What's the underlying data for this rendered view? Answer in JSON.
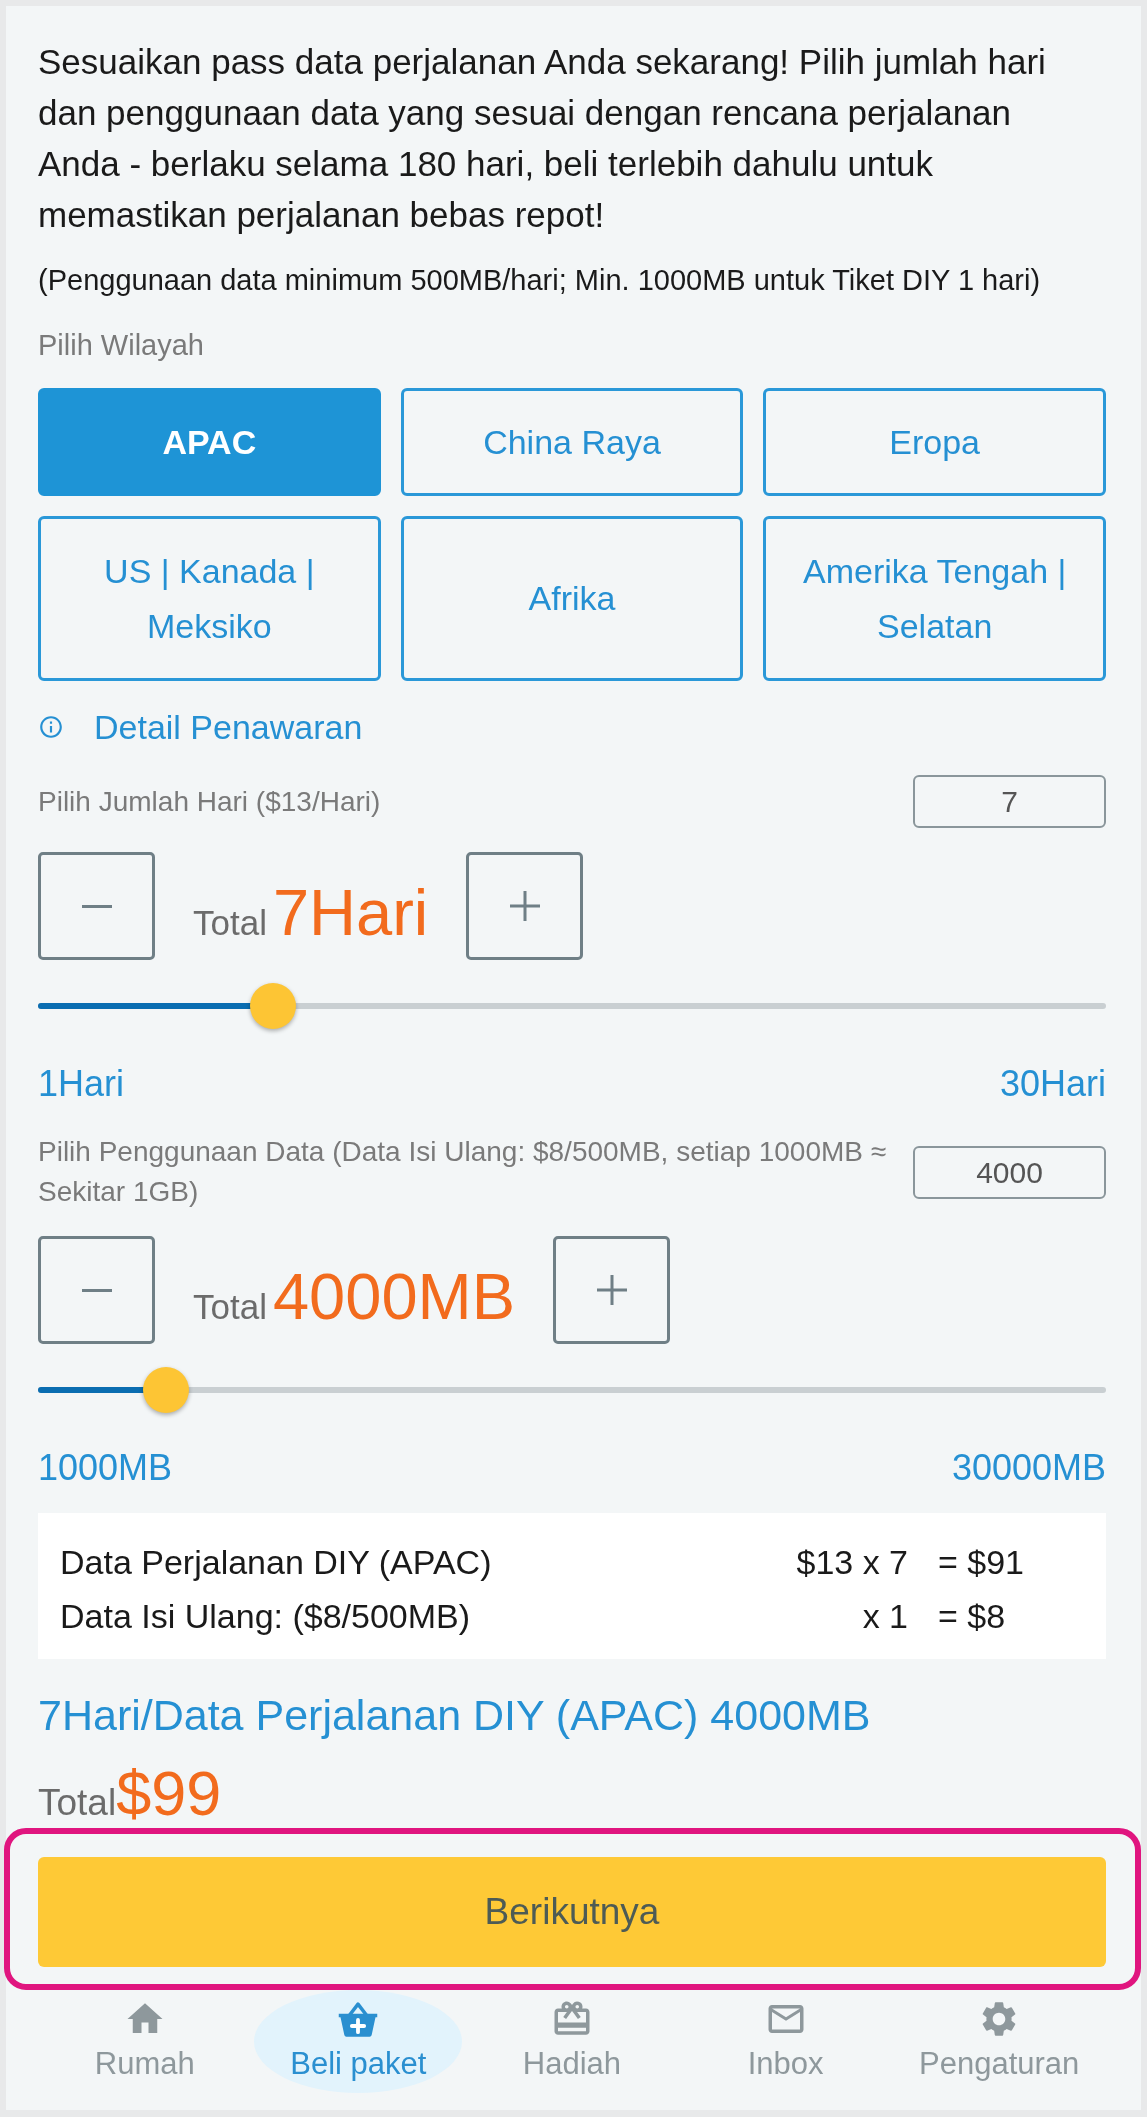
{
  "intro": {
    "text": "Sesuaikan pass data perjalanan Anda sekarang! Pilih jumlah hari dan penggunaan data yang sesuai dengan rencana perjalanan Anda - berlaku selama 180 hari, beli terlebih dahulu untuk memastikan perjalanan bebas repot!",
    "note": "(Penggunaan data minimum 500MB/hari; Min. 1000MB untuk Tiket DIY 1 hari)"
  },
  "region": {
    "label": "Pilih Wilayah",
    "options": [
      {
        "label": "APAC",
        "selected": true
      },
      {
        "label": "China Raya",
        "selected": false
      },
      {
        "label": "Eropa",
        "selected": false
      },
      {
        "label": "US | Kanada | Meksiko",
        "selected": false
      },
      {
        "label": "Afrika",
        "selected": false
      },
      {
        "label": "Amerika Tengah | Selatan",
        "selected": false
      }
    ],
    "detail_link": "Detail Penawaran"
  },
  "days": {
    "label": "Pilih Jumlah Hari ($13/Hari)",
    "value": "7",
    "total_label": "Total",
    "total": "7Hari",
    "level": 0.22,
    "min_label": "1Hari",
    "max_label": "30Hari"
  },
  "data": {
    "label": "Pilih Penggunaan Data (Data Isi Ulang: $8/500MB, setiap 1000MB ≈ Sekitar 1GB)",
    "value": "4000",
    "total_label": "Total",
    "total": "4000MB",
    "level": 0.12,
    "min_label": "1000MB",
    "max_label": "30000MB"
  },
  "summary": {
    "rows": [
      {
        "item": "Data Perjalanan DIY (APAC)",
        "quantity": "$13 x 7",
        "amount": "= $91"
      },
      {
        "item": "Data Isi Ulang: ($8/500MB)",
        "quantity": "x 1",
        "amount": "= $8"
      }
    ]
  },
  "plan_title": "7Hari/Data Perjalanan DIY (APAC) 4000MB",
  "total": {
    "label": "Total",
    "amount": "$99"
  },
  "next_button": {
    "label": "Berikutnya",
    "highlighted": true
  },
  "bottom_nav": [
    {
      "label": "Rumah",
      "selected": false
    },
    {
      "label": "Beli paket",
      "selected": true
    },
    {
      "label": "Hadiah",
      "selected": false
    },
    {
      "label": "Inbox",
      "selected": false
    },
    {
      "label": "Pengaturan",
      "selected": false
    }
  ]
}
